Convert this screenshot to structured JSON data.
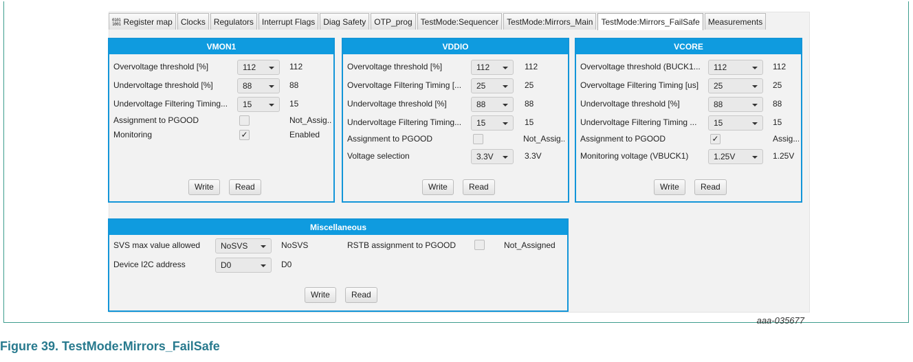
{
  "tabs": [
    {
      "label": "Register map",
      "icon": "binary-icon",
      "icon_glyph": "0101\n1001"
    },
    {
      "label": "Clocks"
    },
    {
      "label": "Regulators"
    },
    {
      "label": "Interrupt Flags"
    },
    {
      "label": "Diag Safety"
    },
    {
      "label": "OTP_prog"
    },
    {
      "label": "TestMode:Sequencer"
    },
    {
      "label": "TestMode:Mirrors_Main"
    },
    {
      "label": "TestMode:Mirrors_FailSafe",
      "active": true
    },
    {
      "label": "Measurements"
    }
  ],
  "vmon1": {
    "title": "VMON1",
    "rows": [
      {
        "label": "Overvoltage threshold [%]",
        "value": "112",
        "readback": "112"
      },
      {
        "label": "Undervoltage threshold [%]",
        "value": "88",
        "readback": "88"
      },
      {
        "label": "Undervoltage Filtering Timing...",
        "value": "15",
        "readback": "15"
      },
      {
        "label": "Assignment to PGOOD",
        "checked": false,
        "readback": "Not_Assig..."
      },
      {
        "label": "Monitoring",
        "checked": true,
        "check_mark": "✓",
        "readback": "Enabled"
      }
    ],
    "write": "Write",
    "read": "Read"
  },
  "vddio": {
    "title": "VDDIO",
    "rows": [
      {
        "label": "Overvoltage threshold [%]",
        "value": "112",
        "readback": "112"
      },
      {
        "label": "Overvoltage Filtering Timing [...",
        "value": "25",
        "readback": "25"
      },
      {
        "label": "Undervoltage threshold [%]",
        "value": "88",
        "readback": "88"
      },
      {
        "label": "Undervoltage Filtering Timing...",
        "value": "15",
        "readback": "15"
      },
      {
        "label": "Assignment to PGOOD",
        "checked": false,
        "readback": "Not_Assig..."
      },
      {
        "label": "Voltage selection",
        "value": "3.3V",
        "readback": "3.3V"
      }
    ],
    "write": "Write",
    "read": "Read"
  },
  "vcore": {
    "title": "VCORE",
    "rows": [
      {
        "label": "Overvoltage threshold (BUCK1...",
        "value": "112",
        "readback": "112"
      },
      {
        "label": "Overvoltage Filtering Timing [us]",
        "value": "25",
        "readback": "25"
      },
      {
        "label": "Undervoltage threshold [%]",
        "value": "88",
        "readback": "88"
      },
      {
        "label": "Undervoltage Filtering Timing ...",
        "value": "15",
        "readback": "15"
      },
      {
        "label": "Assignment to PGOOD",
        "checked": true,
        "check_mark": "✓",
        "readback": "Assig..."
      },
      {
        "label": "Monitoring voltage (VBUCK1)",
        "value": "1.25V",
        "readback": "1.25V"
      }
    ],
    "write": "Write",
    "read": "Read"
  },
  "misc": {
    "title": "Miscellaneous",
    "svs_label": "SVS max value allowed",
    "svs_value": "NoSVS",
    "svs_readback": "NoSVS",
    "rstb_label": "RSTB assignment to PGOOD",
    "rstb_checked": false,
    "rstb_readback": "Not_Assigned",
    "i2c_label": "Device I2C address",
    "i2c_value": "D0",
    "i2c_readback": "D0",
    "write": "Write",
    "read": "Read"
  },
  "figure_ref": "aaa-035677",
  "caption": "Figure 39.  TestMode:Mirrors_FailSafe",
  "colors": {
    "panel_border": "#1295d8",
    "panel_header": "#0f9bdf",
    "caption": "#287a8e"
  }
}
